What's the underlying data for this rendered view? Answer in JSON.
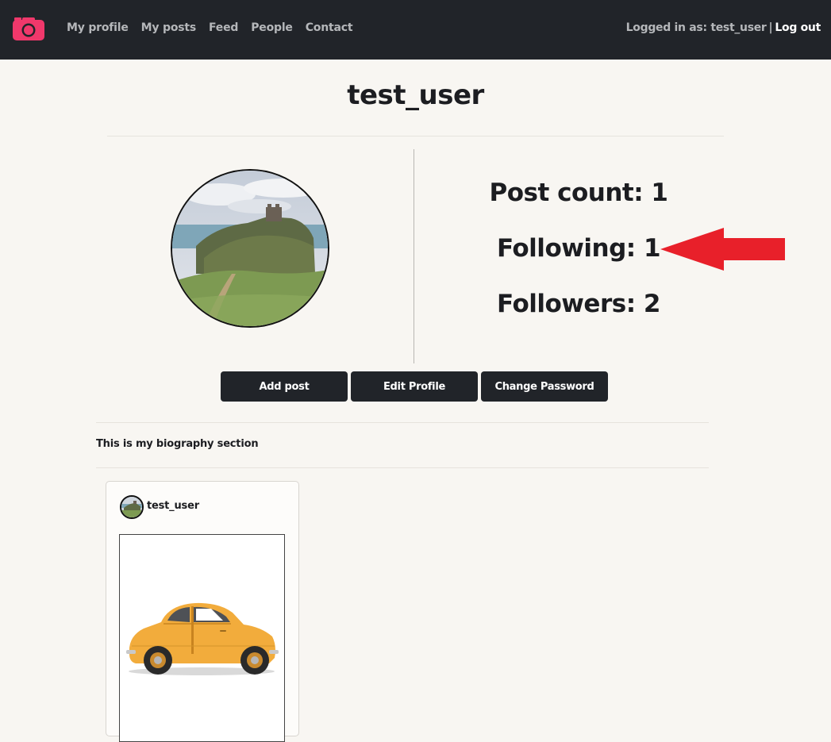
{
  "nav": {
    "brand_icon": "camera-icon",
    "brand_color": "#f0386b",
    "links": [
      "My profile",
      "My posts",
      "Feed",
      "People",
      "Contact"
    ],
    "logged_in_label": "Logged in as: test_user",
    "separator": "|",
    "logout_label": "Log out"
  },
  "profile": {
    "username": "test_user",
    "avatar_icon": "castle-landscape-photo",
    "post_count": "Post count: 1",
    "following": "Following: 1",
    "followers": "Followers: 2",
    "annotation_icon": "red-arrow-icon",
    "annotation_color": "#e8202a"
  },
  "actions": {
    "add_post": "Add post",
    "edit_profile": "Edit Profile",
    "change_password": "Change Password"
  },
  "bio": "This is my biography section",
  "posts": [
    {
      "username": "test_user",
      "image_icon": "yellow-car-photo"
    }
  ]
}
